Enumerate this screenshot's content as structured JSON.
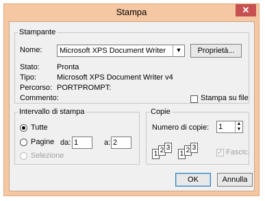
{
  "dialog": {
    "title": "Stampa",
    "close_glyph": "✕"
  },
  "printer": {
    "legend": "Stampante",
    "name_label": "Nome:",
    "name_value": "Microsoft XPS Document Writer",
    "properties_button": "Proprietà...",
    "status_label": "Stato:",
    "status_value": "Pronta",
    "type_label": "Tipo:",
    "type_value": "Microsoft XPS Document Writer v4",
    "path_label": "Percorso:",
    "path_value": "PORTPROMPT:",
    "comment_label": "Commento:",
    "print_to_file_label": "Stampa su file",
    "print_to_file_checked": false
  },
  "range": {
    "legend": "Intervallo di stampa",
    "all_label": "Tutte",
    "pages_label": "Pagine",
    "from_label": "da:",
    "from_value": "1",
    "to_label": "a:",
    "to_value": "2",
    "selection_label": "Selezione",
    "selected": "all"
  },
  "copies": {
    "legend": "Copie",
    "count_label": "Numero di copie:",
    "count_value": "1",
    "collate_label": "Fascic.",
    "collate_checked": true,
    "collate_disabled": true,
    "collate_icon_pages": [
      "1",
      "2",
      "3"
    ]
  },
  "buttons": {
    "ok": "OK",
    "cancel": "Annulla"
  }
}
